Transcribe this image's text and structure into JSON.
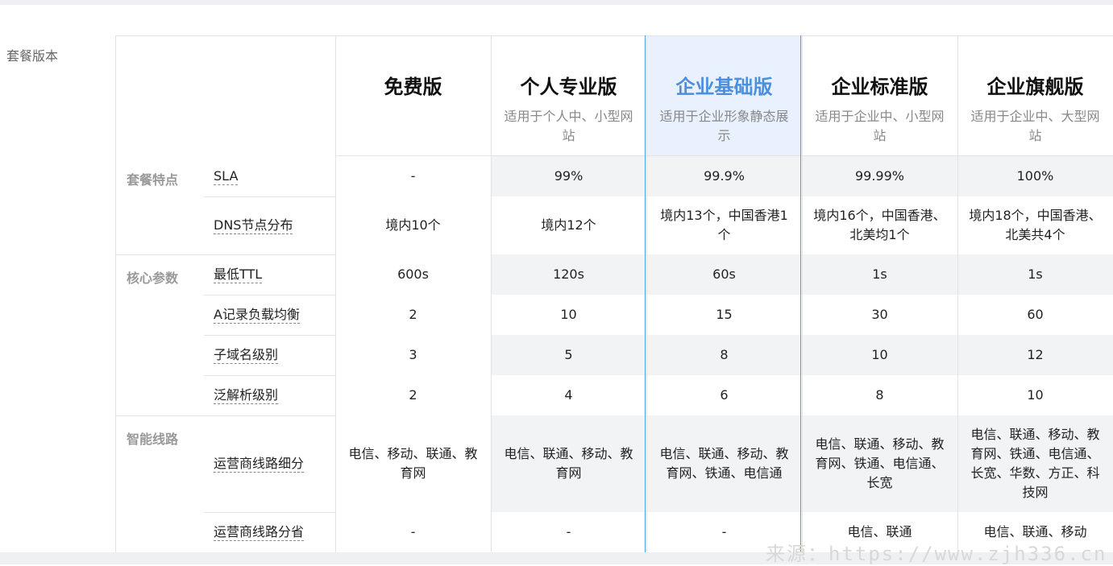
{
  "section_label": "套餐版本",
  "plans": [
    {
      "name": "免费版",
      "desc": ""
    },
    {
      "name": "个人专业版",
      "desc": "适用于个人中、小型网站"
    },
    {
      "name": "企业基础版",
      "desc": "适用于企业形象静态展示"
    },
    {
      "name": "企业标准版",
      "desc": "适用于企业中、小型网站"
    },
    {
      "name": "企业旗舰版",
      "desc": "适用于企业中、大型网站"
    }
  ],
  "featured_plan_index": 2,
  "groups": [
    {
      "label": "套餐特点"
    },
    {
      "label": "核心参数"
    },
    {
      "label": "智能线路"
    }
  ],
  "rows": [
    {
      "feature": "SLA",
      "values": [
        "-",
        "99%",
        "99.9%",
        "99.99%",
        "100%"
      ]
    },
    {
      "feature": "DNS节点分布",
      "values": [
        "境内10个",
        "境内12个",
        "境内13个，中国香港1个",
        "境内16个，中国香港、北美均1个",
        "境内18个，中国香港、北美共4个"
      ]
    },
    {
      "feature": "最低TTL",
      "values": [
        "600s",
        "120s",
        "60s",
        "1s",
        "1s"
      ]
    },
    {
      "feature": "A记录负载均衡",
      "values": [
        "2",
        "10",
        "15",
        "30",
        "60"
      ]
    },
    {
      "feature": "子域名级别",
      "values": [
        "3",
        "5",
        "8",
        "10",
        "12"
      ]
    },
    {
      "feature": "泛解析级别",
      "values": [
        "2",
        "4",
        "6",
        "8",
        "10"
      ]
    },
    {
      "feature": "运营商线路细分",
      "values": [
        "电信、移动、联通、教育网",
        "电信、联通、移动、教育网",
        "电信、联通、移动、教育网、铁通、电信通",
        "电信、联通、移动、教育网、铁通、电信通、长宽",
        "电信、联通、移动、教育网、铁通、电信通、长宽、华数、方正、科技网"
      ]
    },
    {
      "feature": "运营商线路分省",
      "values": [
        "-",
        "-",
        "-",
        "电信、联通",
        "电信、联通、移动"
      ]
    }
  ],
  "watermark": "来源：https://www.zjh336.cn",
  "colors": {
    "featured_border": "#4aa0e6",
    "featured_title": "#4a8fe0",
    "shade": "#f2f3f5"
  }
}
